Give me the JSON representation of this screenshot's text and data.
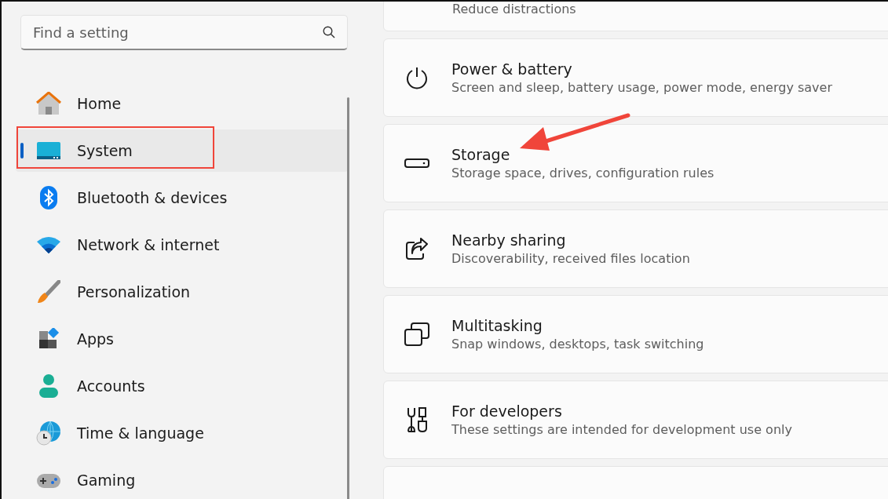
{
  "search": {
    "placeholder": "Find a setting"
  },
  "sidebar": {
    "items": [
      {
        "label": "Home",
        "selected": false
      },
      {
        "label": "System",
        "selected": true
      },
      {
        "label": "Bluetooth & devices",
        "selected": false
      },
      {
        "label": "Network & internet",
        "selected": false
      },
      {
        "label": "Personalization",
        "selected": false
      },
      {
        "label": "Apps",
        "selected": false
      },
      {
        "label": "Accounts",
        "selected": false
      },
      {
        "label": "Time & language",
        "selected": false
      },
      {
        "label": "Gaming",
        "selected": false
      }
    ]
  },
  "cards": [
    {
      "kind": "partial",
      "subtitle": "Reduce distractions"
    },
    {
      "kind": "full",
      "title": "Power & battery",
      "subtitle": "Screen and sleep, battery usage, power mode, energy saver"
    },
    {
      "kind": "full",
      "title": "Storage",
      "subtitle": "Storage space, drives, configuration rules"
    },
    {
      "kind": "full",
      "title": "Nearby sharing",
      "subtitle": "Discoverability, received files location"
    },
    {
      "kind": "full",
      "title": "Multitasking",
      "subtitle": "Snap windows, desktops, task switching"
    },
    {
      "kind": "full",
      "title": "For developers",
      "subtitle": "These settings are intended for development use only"
    },
    {
      "kind": "empty"
    }
  ]
}
